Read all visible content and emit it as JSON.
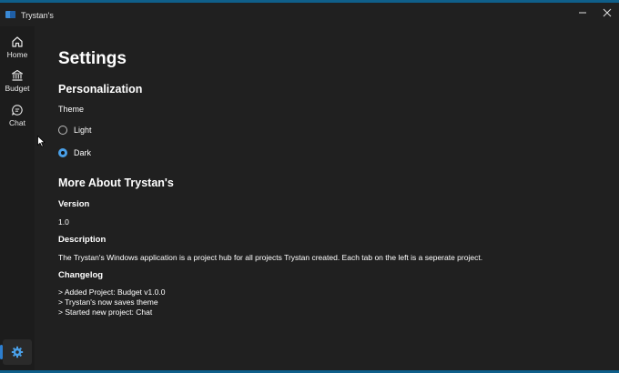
{
  "window": {
    "title": "Trystan's",
    "minimize_symbol": "—",
    "close_symbol": "✕"
  },
  "sidebar": {
    "items": [
      {
        "label": "Home",
        "icon": "home-icon"
      },
      {
        "label": "Budget",
        "icon": "bank-icon"
      },
      {
        "label": "Chat",
        "icon": "chat-icon"
      }
    ],
    "settings_icon": "gear-icon"
  },
  "settings": {
    "title": "Settings",
    "personalization": {
      "title": "Personalization",
      "theme_label": "Theme",
      "options": [
        {
          "label": "Light",
          "selected": false
        },
        {
          "label": "Dark",
          "selected": true
        }
      ]
    },
    "about": {
      "title": "More About Trystan's",
      "version_label": "Version",
      "version": "1.0",
      "description_label": "Description",
      "description": "The Trystan's Windows application is a project hub for all projects Trystan created. Each tab on the left is a seperate project.",
      "changelog_label": "Changelog",
      "changelog": [
        "> Added Project: Budget v1.0.0",
        "> Trystan's now saves theme",
        "> Started new project: Chat"
      ]
    }
  },
  "colors": {
    "accent": "#4aa0e8",
    "background": "#202020",
    "sidebar": "#1c1c1c",
    "frame": "#0f5f8a"
  }
}
